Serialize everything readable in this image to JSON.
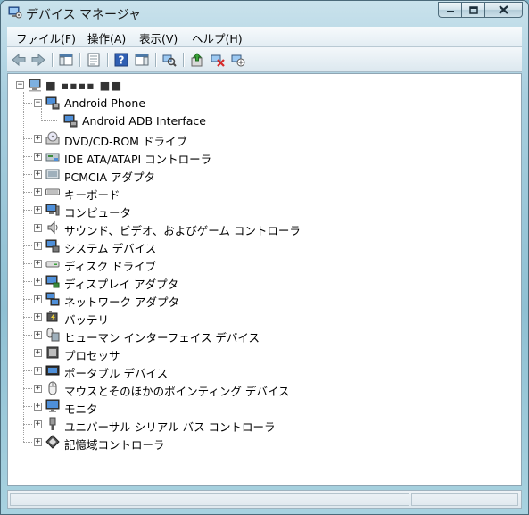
{
  "window": {
    "title": "デバイス マネージャ",
    "controls": {
      "minimize": "minimize",
      "maximize": "maximize",
      "close": "close"
    }
  },
  "menu": [
    {
      "label": "ファイル(F)"
    },
    {
      "label": "操作(A)"
    },
    {
      "label": "表示(V)"
    },
    {
      "label": "ヘルプ(H)"
    }
  ],
  "toolbar": {
    "buttons": [
      "back-icon",
      "forward-icon",
      "console-tree-icon",
      "properties-icon",
      "help-icon",
      "action-pane-icon",
      "scan-hardware-icon",
      "update-driver-icon",
      "uninstall-icon",
      "disable-device-icon"
    ]
  },
  "tree": {
    "root": {
      "label": "■ ▪▪▪▪ ■■",
      "expanded": true
    },
    "items": [
      {
        "label": "Android Phone",
        "expanded": true,
        "children": [
          {
            "label": "Android ADB Interface"
          }
        ]
      },
      {
        "label": "DVD/CD-ROM ドライブ"
      },
      {
        "label": "IDE ATA/ATAPI コントローラ"
      },
      {
        "label": "PCMCIA アダプタ"
      },
      {
        "label": "キーボード"
      },
      {
        "label": "コンピュータ"
      },
      {
        "label": "サウンド、ビデオ、およびゲーム コントローラ"
      },
      {
        "label": "システム デバイス"
      },
      {
        "label": "ディスク ドライブ"
      },
      {
        "label": "ディスプレイ アダプタ"
      },
      {
        "label": "ネットワーク アダプタ"
      },
      {
        "label": "バッテリ"
      },
      {
        "label": "ヒューマン インターフェイス デバイス"
      },
      {
        "label": "プロセッサ"
      },
      {
        "label": "ポータブル デバイス"
      },
      {
        "label": "マウスとそのほかのポインティング デバイス"
      },
      {
        "label": "モニタ"
      },
      {
        "label": "ユニバーサル シリアル バス コントローラ"
      },
      {
        "label": "記憶域コントローラ"
      }
    ]
  }
}
